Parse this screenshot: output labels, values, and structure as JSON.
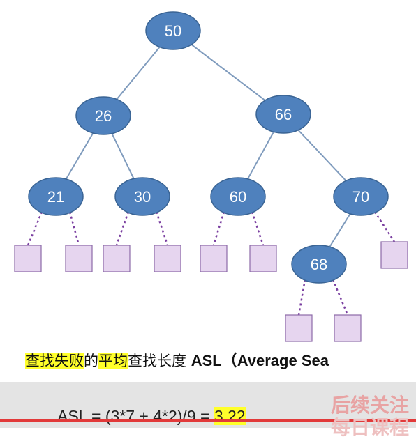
{
  "tree": {
    "nodes": [
      {
        "id": "50",
        "label": "50"
      },
      {
        "id": "26",
        "label": "26"
      },
      {
        "id": "66",
        "label": "66"
      },
      {
        "id": "21",
        "label": "21"
      },
      {
        "id": "30",
        "label": "30"
      },
      {
        "id": "60",
        "label": "60"
      },
      {
        "id": "70",
        "label": "70"
      },
      {
        "id": "68",
        "label": "68"
      }
    ],
    "edges": [
      [
        "50",
        "26"
      ],
      [
        "50",
        "66"
      ],
      [
        "26",
        "21"
      ],
      [
        "26",
        "30"
      ],
      [
        "66",
        "60"
      ],
      [
        "66",
        "70"
      ],
      [
        "70",
        "68"
      ]
    ],
    "failure_nodes_count": 9,
    "colors": {
      "node_fill": "#4f81bd",
      "node_stroke": "#3a6494",
      "edge": "#7f9bbd",
      "failure_fill": "#e6d5ef",
      "failure_stroke": "#8c6aa8",
      "failure_edge": "#7a3fa0"
    }
  },
  "caption": {
    "part1": "查找失败",
    "part2": "的",
    "part3": "平均",
    "part4": "查找长度 ",
    "part5": "ASL（Average Sea"
  },
  "formula": {
    "text": "ASL = (3*7 + 4*2)/9 = ",
    "result": "3.22"
  },
  "overlay": {
    "line1": "后续关注",
    "line2": "每日课程"
  }
}
